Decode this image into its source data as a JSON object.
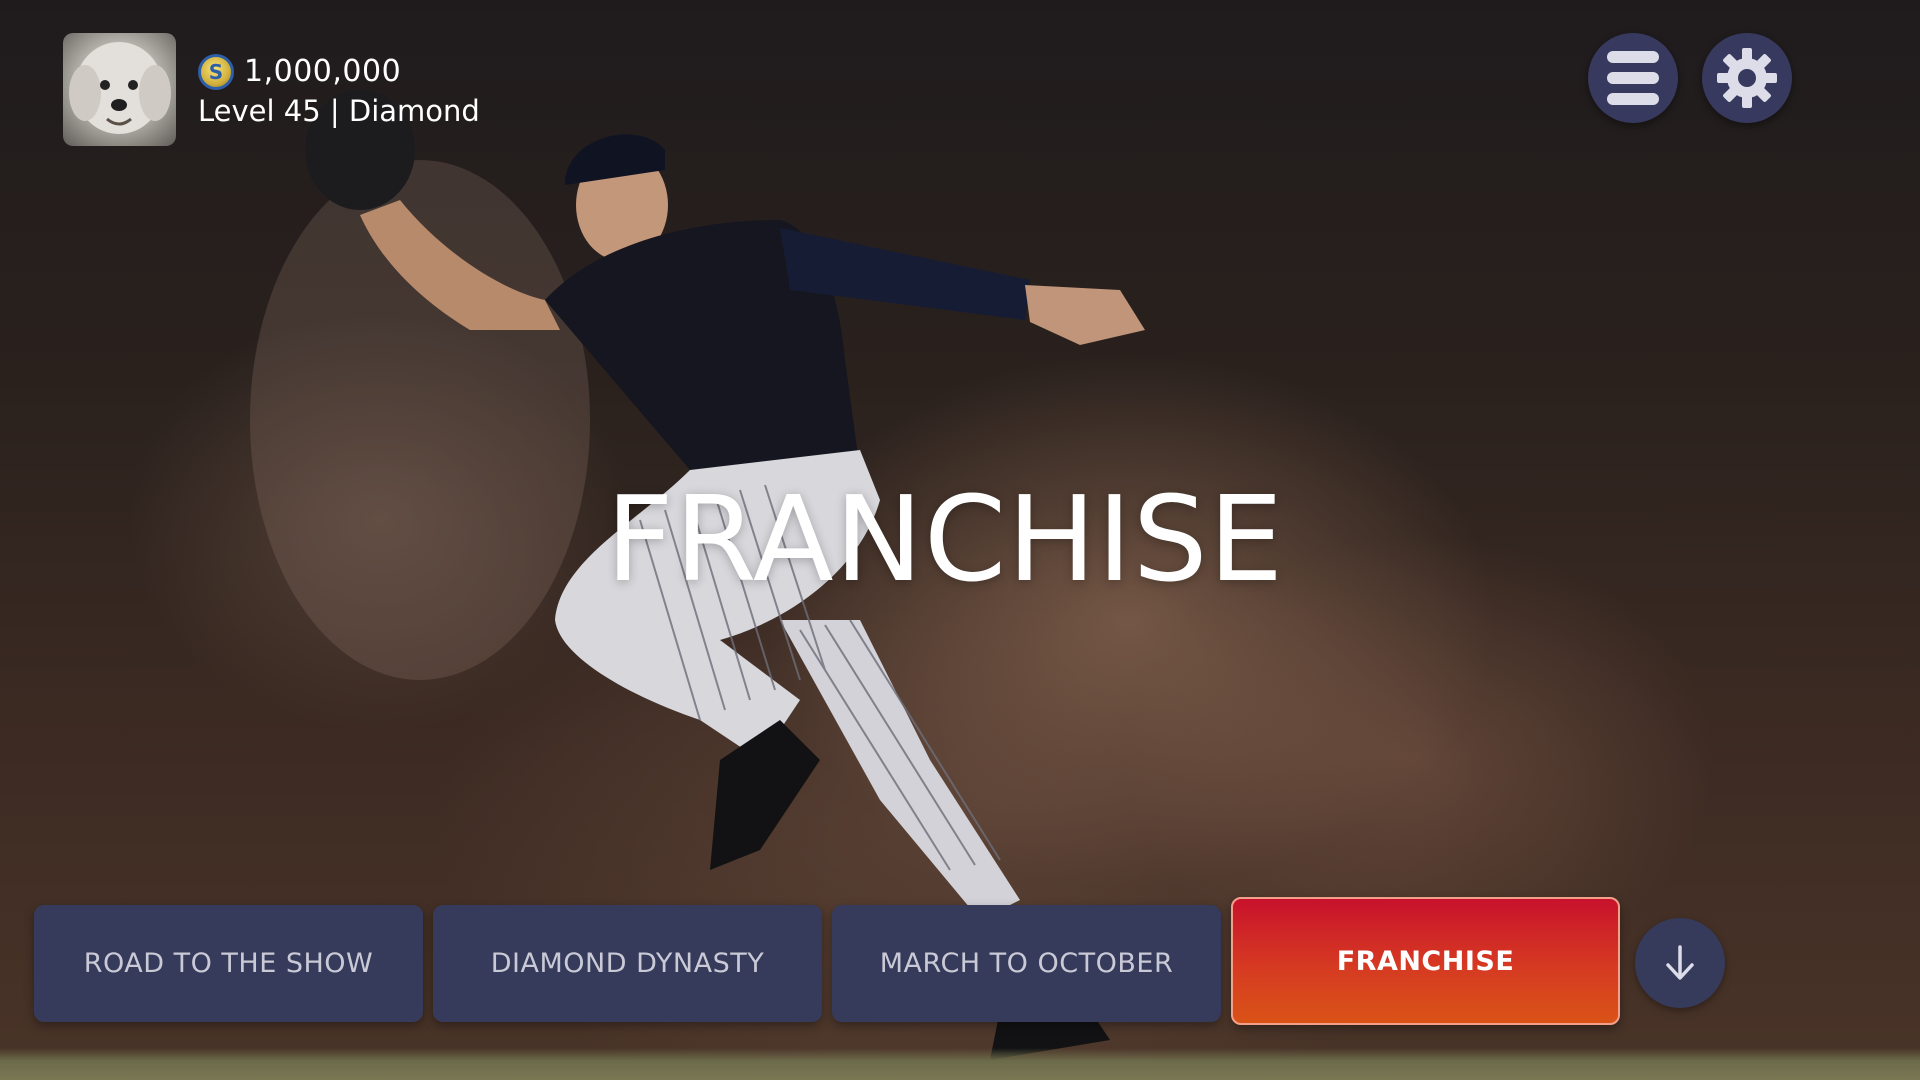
{
  "profile": {
    "avatar_icon": "dog-avatar-icon",
    "coin_icon": "stubs-coin-icon",
    "coin_symbol": "S",
    "coins": "1,000,000",
    "level": "Level 45 | Diamond"
  },
  "header": {
    "menu_icon": "hamburger-menu-icon",
    "settings_icon": "gear-icon"
  },
  "hero": {
    "title": "FRANCHISE"
  },
  "modes": [
    {
      "label": "ROAD TO THE SHOW",
      "selected": false
    },
    {
      "label": "DIAMOND DYNASTY",
      "selected": false
    },
    {
      "label": "MARCH TO OCTOBER",
      "selected": false
    },
    {
      "label": "FRANCHISE",
      "selected": true
    }
  ],
  "scroll": {
    "icon": "arrow-down-icon"
  },
  "colors": {
    "button_bg": "#363a5b",
    "active_top": "#c8122c",
    "active_bottom": "#d95317",
    "text": "#ffffff"
  }
}
